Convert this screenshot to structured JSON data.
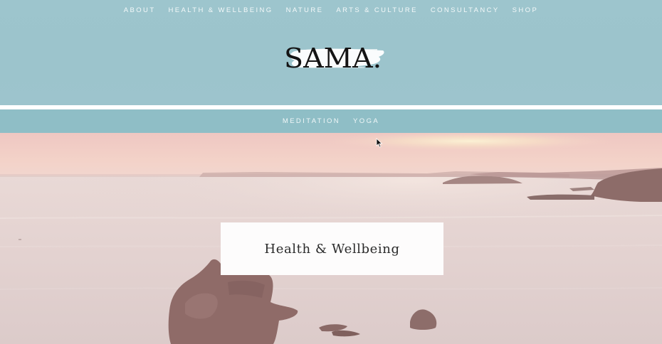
{
  "top_nav": {
    "items": [
      {
        "label": "ABOUT"
      },
      {
        "label": "HEALTH & WELLBEING"
      },
      {
        "label": "NATURE"
      },
      {
        "label": "ARTS & CULTURE"
      },
      {
        "label": "CONSULTANCY"
      },
      {
        "label": "SHOP"
      }
    ]
  },
  "logo": {
    "text": "SAMA."
  },
  "sub_nav": {
    "items": [
      {
        "label": "MEDITATION"
      },
      {
        "label": "YOGA"
      }
    ]
  },
  "hero": {
    "title": "Health & Wellbeing"
  },
  "colors": {
    "header_bg": "#9dc5cd",
    "sub_nav_bg": "#8fbec6",
    "nav_text": "#f4f9fa",
    "logo_text": "#141414",
    "card_bg": "#fdfcfc"
  },
  "icons": {
    "cursor": "arrow-cursor-icon"
  }
}
